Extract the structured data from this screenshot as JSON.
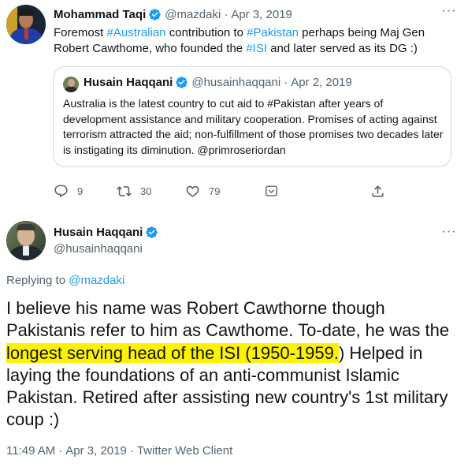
{
  "colors": {
    "accent": "#1d9bf0",
    "text": "#0f1419",
    "muted": "#536471",
    "highlight": "#fff200",
    "border": "#cfd9de"
  },
  "tweet1": {
    "author_name": "Mohammad Taqi",
    "handle": "@mazdaki",
    "separator": "·",
    "date": "Apr 3, 2019",
    "text_parts": [
      {
        "text": "Foremost ",
        "type": "plain"
      },
      {
        "text": "#Australian",
        "type": "hashtag"
      },
      {
        "text": " contribution to ",
        "type": "plain"
      },
      {
        "text": "#Pakistan",
        "type": "hashtag"
      },
      {
        "text": " perhaps being Maj Gen Robert Cawthome, who founded the ",
        "type": "plain"
      },
      {
        "text": "#ISI",
        "type": "hashtag"
      },
      {
        "text": " and later served as its DG :)",
        "type": "plain"
      }
    ],
    "quote": {
      "author_name": "Husain Haqqani",
      "handle": "@husainhaqqani",
      "separator": "·",
      "date": "Apr 2, 2019",
      "text": "Australia is the latest country to cut aid to #Pakistan after years of development assistance and military cooperation. Promises of acting against terrorism attracted the aid; non-fulfillment of those promises two decades later is instigating its diminution.  @primroseriordan"
    },
    "actions": {
      "replies": "9",
      "retweets": "30",
      "likes": "79"
    }
  },
  "tweet2": {
    "author_name": "Husain Haqqani",
    "handle": "@husainhaqqani",
    "replying_label": "Replying to ",
    "replying_to": "@mazdaki",
    "text_before": "I believe his name was Robert Cawthorne though Pakistanis refer to him as Cawthome. To-date, he was the ",
    "text_highlight": "longest serving head of the ISI (1950-1959.",
    "text_after": ") Helped in laying the foundations of an anti-communist Islamic Pakistan. Retired after assisting new country's 1st military coup :)",
    "time": "11:49 AM",
    "separator": "·",
    "date": "Apr 3, 2019",
    "client_separator": "·",
    "client": "Twitter Web Client"
  }
}
